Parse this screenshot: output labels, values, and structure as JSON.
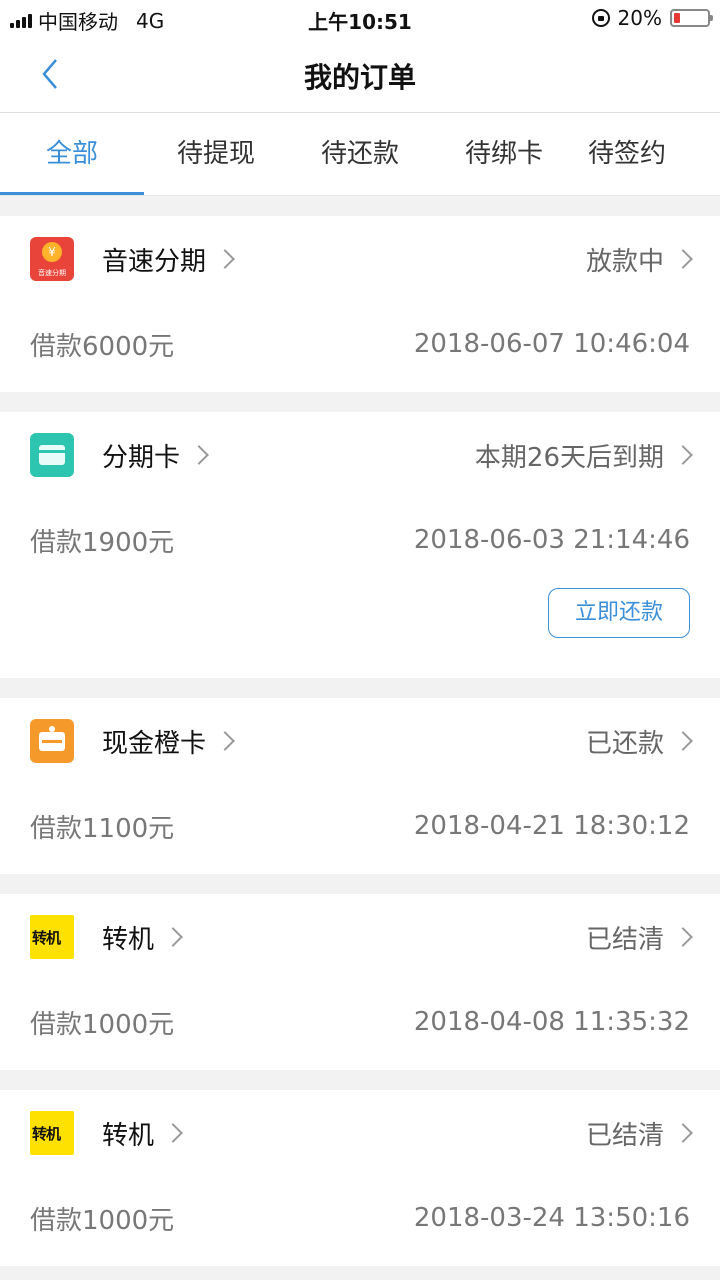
{
  "status_bar": {
    "carrier": "中国移动",
    "network": "4G",
    "time": "上午10:51",
    "battery": "20%",
    "battery_level": 0.2
  },
  "header": {
    "title": "我的订单",
    "back_icon": "chevron-left-icon"
  },
  "tabs": [
    {
      "label": "全部",
      "active": true
    },
    {
      "label": "待提现",
      "active": false
    },
    {
      "label": "待还款",
      "active": false
    },
    {
      "label": "待绑卡",
      "active": false
    },
    {
      "label": "待签约",
      "active": false
    }
  ],
  "orders": [
    {
      "provider": "音速分期",
      "status": "放款中",
      "amount": "借款6000元",
      "datetime": "2018-06-07 10:46:04",
      "logo_text": "音速分期"
    },
    {
      "provider": "分期卡",
      "status": "本期26天后到期",
      "amount": "借款1900元",
      "datetime": "2018-06-03 21:14:46",
      "action": "立即还款"
    },
    {
      "provider": "现金橙卡",
      "status": "已还款",
      "amount": "借款1100元",
      "datetime": "2018-04-21 18:30:12"
    },
    {
      "provider": "转机",
      "status": "已结清",
      "amount": "借款1000元",
      "datetime": "2018-04-08 11:35:32",
      "logo_text": "转机"
    },
    {
      "provider": "转机",
      "status": "已结清",
      "amount": "借款1000元",
      "datetime": "2018-03-24 13:50:16",
      "logo_text": "转机"
    }
  ],
  "colors": {
    "accent": "#3b8fd9",
    "battery_low": "#e53935"
  }
}
